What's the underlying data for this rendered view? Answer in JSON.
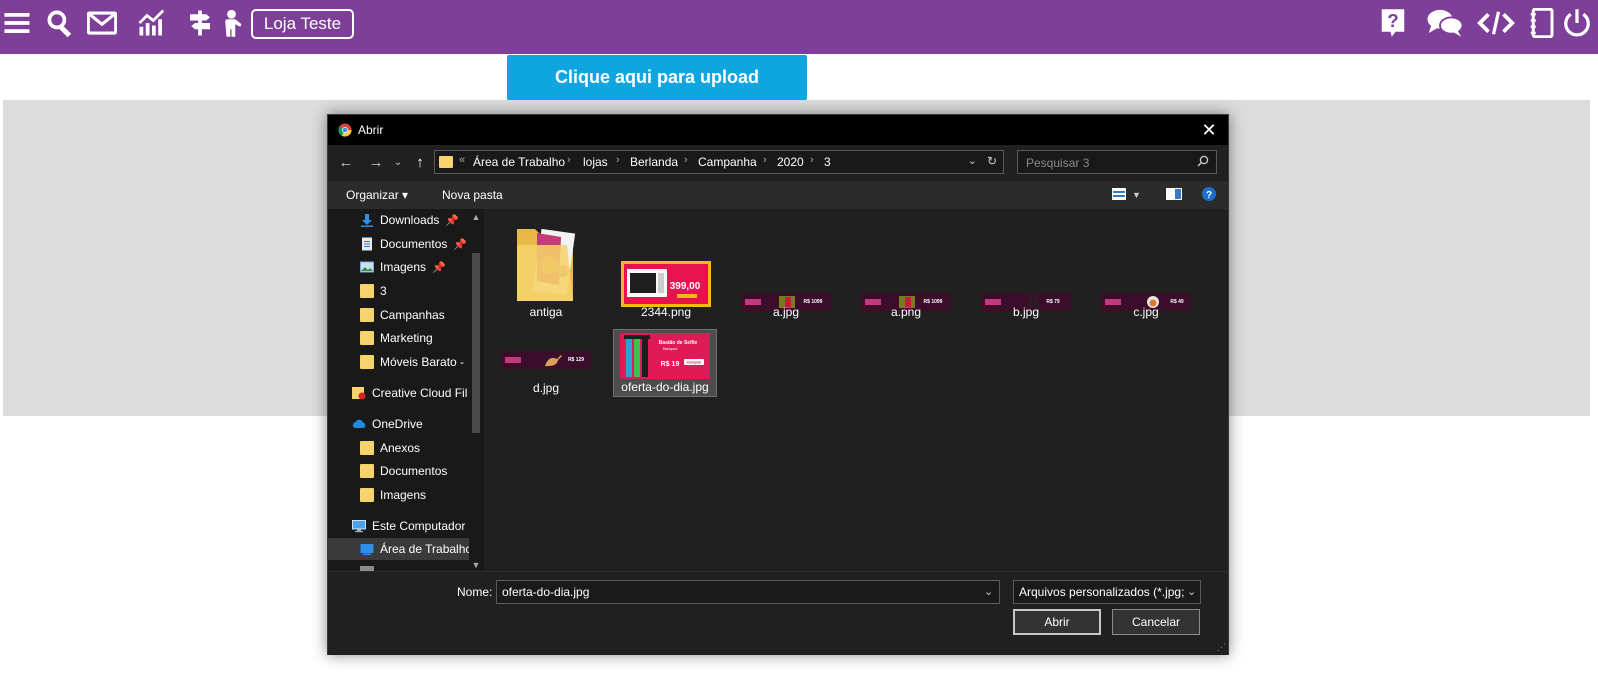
{
  "topbar": {
    "store_label": "Loja Teste",
    "icons": [
      "menu-icon",
      "search-icon",
      "mail-icon",
      "chart-icon",
      "signpost-icon",
      "user-presenter-icon",
      "help-icon",
      "chat-icon",
      "code-icon",
      "notebook-icon",
      "power-icon"
    ],
    "color": "#7e3f98"
  },
  "upload": {
    "label": "Clique aqui para upload",
    "color": "#0ea5e0"
  },
  "dialog": {
    "title": "Abrir",
    "breadcrumb": [
      "Área de Trabalho",
      "lojas",
      "Berlanda",
      "Campanha",
      "2020",
      "3"
    ],
    "search_placeholder": "Pesquisar 3",
    "toolbar": {
      "organize": "Organizar ▾",
      "new_folder": "Nova pasta"
    },
    "nav": {
      "quick": [
        {
          "label": "Downloads",
          "pinned": "📌"
        },
        {
          "label": "Documentos",
          "pinned": "📌"
        },
        {
          "label": "Imagens",
          "pinned": "📌"
        },
        {
          "label": "3"
        },
        {
          "label": "Campanhas"
        },
        {
          "label": "Marketing"
        },
        {
          "label": "Móveis Barato -"
        }
      ],
      "creative_cloud": "Creative Cloud Fil",
      "onedrive": "OneDrive",
      "onedrive_items": [
        "Anexos",
        "Documentos",
        "Imagens"
      ],
      "this_pc": "Este Computador",
      "desktop": "Área de Trabalho"
    },
    "files": [
      {
        "name": "antiga",
        "kind": "folder"
      },
      {
        "name": "2344.png",
        "kind": "image-microwave"
      },
      {
        "name": "a.jpg",
        "kind": "banner"
      },
      {
        "name": "a.png",
        "kind": "banner"
      },
      {
        "name": "b.jpg",
        "kind": "banner"
      },
      {
        "name": "c.jpg",
        "kind": "banner"
      },
      {
        "name": "d.jpg",
        "kind": "banner"
      },
      {
        "name": "oferta-do-dia.jpg",
        "kind": "offer",
        "selected": true
      }
    ],
    "thumb_text": {
      "price_2344": "399,00",
      "a_price": "R$ 1099",
      "a_png_price": "R$ 1099",
      "b_price": "R$ 79",
      "c_price": "R$ 49",
      "d_price": "R$ 129",
      "offer_title": "Bastão de Selfie",
      "offer_sub": "Monopod",
      "offer_price": "R$ 19",
      "offer_btn": "Comprar"
    },
    "name_label": "Nome:",
    "name_value": "oferta-do-dia.jpg",
    "filter_value": "Arquivos personalizados (*.jpg;",
    "open_label": "Abrir",
    "cancel_label": "Cancelar"
  }
}
